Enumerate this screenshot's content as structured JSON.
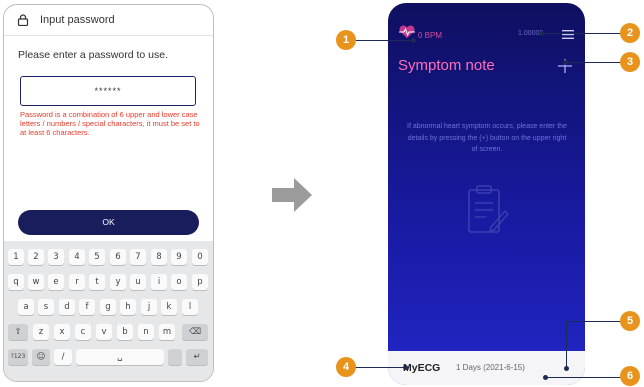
{
  "password_screen": {
    "title": "Input password",
    "instruction": "Please enter a password to use.",
    "input_value": "******",
    "rule_text": "Password is a combination of 6 upper and lower case letters / numbers / special characters, it must be set to at least 6 characters.",
    "ok_label": "OK"
  },
  "keyboard": {
    "rows": [
      [
        "1",
        "2",
        "3",
        "4",
        "5",
        "6",
        "7",
        "8",
        "9",
        "0"
      ],
      [
        "q",
        "w",
        "e",
        "r",
        "t",
        "y",
        "u",
        "i",
        "o",
        "p"
      ],
      [
        "a",
        "s",
        "d",
        "f",
        "g",
        "h",
        "j",
        "k",
        "l"
      ],
      [
        "⇧",
        "z",
        "x",
        "c",
        "v",
        "b",
        "n",
        "m",
        "⌫"
      ],
      [
        "?123",
        "☺",
        "/",
        "␣",
        "",
        "↵"
      ]
    ]
  },
  "note_screen": {
    "bpm": "0 BPM",
    "battery": "1.00000",
    "title": "Symptom note",
    "empty_message": "If abnormal heart symptom occurs, please enter the details by pressing the (+) button on the upper right of screen.",
    "app_name": "MyECG",
    "days": "1 Days (2021-6-15)"
  },
  "callouts": [
    "1",
    "2",
    "3",
    "4",
    "5",
    "6"
  ],
  "colors": {
    "navy_button": "#1a1d5c",
    "warning_red": "#e53b2c",
    "accent_pink": "#ff6fb8",
    "callout_orange": "#e8941c",
    "arrow_gray": "#9b9b9b"
  }
}
